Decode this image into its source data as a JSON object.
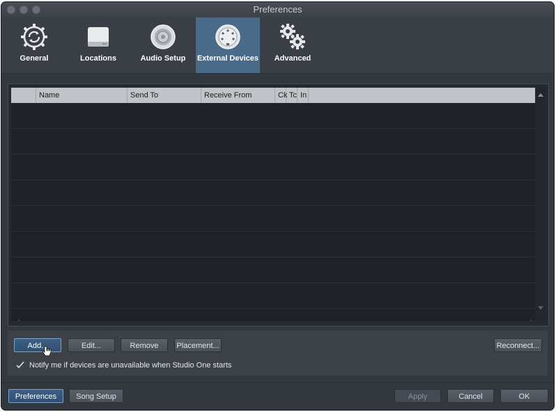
{
  "window": {
    "title": "Preferences"
  },
  "toolbar": {
    "tabs": [
      {
        "label": "General",
        "icon": "gear-refresh-icon",
        "active": false
      },
      {
        "label": "Locations",
        "icon": "drive-icon",
        "active": false
      },
      {
        "label": "Audio Setup",
        "icon": "speaker-icon",
        "active": false
      },
      {
        "label": "External Devices",
        "icon": "midi-connector-icon",
        "active": true
      },
      {
        "label": "Advanced",
        "icon": "gears-icon",
        "active": false
      }
    ]
  },
  "table": {
    "columns": [
      "",
      "Name",
      "Send To",
      "Receive From",
      "Ck",
      "Tc",
      "In"
    ],
    "rows": []
  },
  "actions": {
    "add": "Add...",
    "edit": "Edit...",
    "remove": "Remove",
    "placement": "Placement...",
    "reconnect": "Reconnect..."
  },
  "notify": {
    "label": "Notify me if devices are unavailable when Studio One starts",
    "checked": true
  },
  "footer": {
    "preferences": "Preferences",
    "song_setup": "Song Setup",
    "apply": "Apply",
    "cancel": "Cancel",
    "ok": "OK"
  },
  "colors": {
    "accent": "#4a6a8a",
    "background": "#33383f",
    "header": "#c0c3c7"
  }
}
